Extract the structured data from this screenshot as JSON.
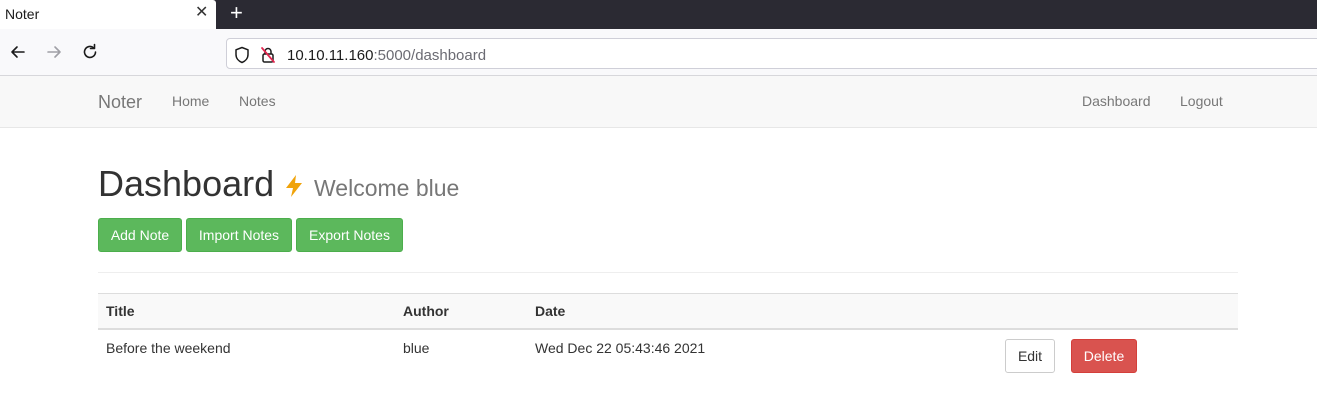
{
  "browser": {
    "tab_title": "Noter",
    "tab_close": "✕",
    "new_tab": "+",
    "url_host": "10.10.11.160",
    "url_rest": ":5000/dashboard"
  },
  "navbar": {
    "brand": "Noter",
    "left_links": [
      "Home",
      "Notes"
    ],
    "right_links": [
      "Dashboard",
      "Logout"
    ]
  },
  "page": {
    "heading": "Dashboard",
    "welcome": "Welcome blue",
    "buttons": [
      "Add Note",
      "Import Notes",
      "Export Notes"
    ]
  },
  "table": {
    "columns": [
      "Title",
      "Author",
      "Date"
    ],
    "rows": [
      {
        "title": "Before the weekend",
        "author": "blue",
        "date": "Wed Dec 22 05:43:46 2021",
        "edit_label": "Edit",
        "delete_label": "Delete"
      }
    ]
  },
  "colors": {
    "success": "#5cb85c",
    "danger": "#d9534f",
    "bolt": "#f0a30a"
  }
}
